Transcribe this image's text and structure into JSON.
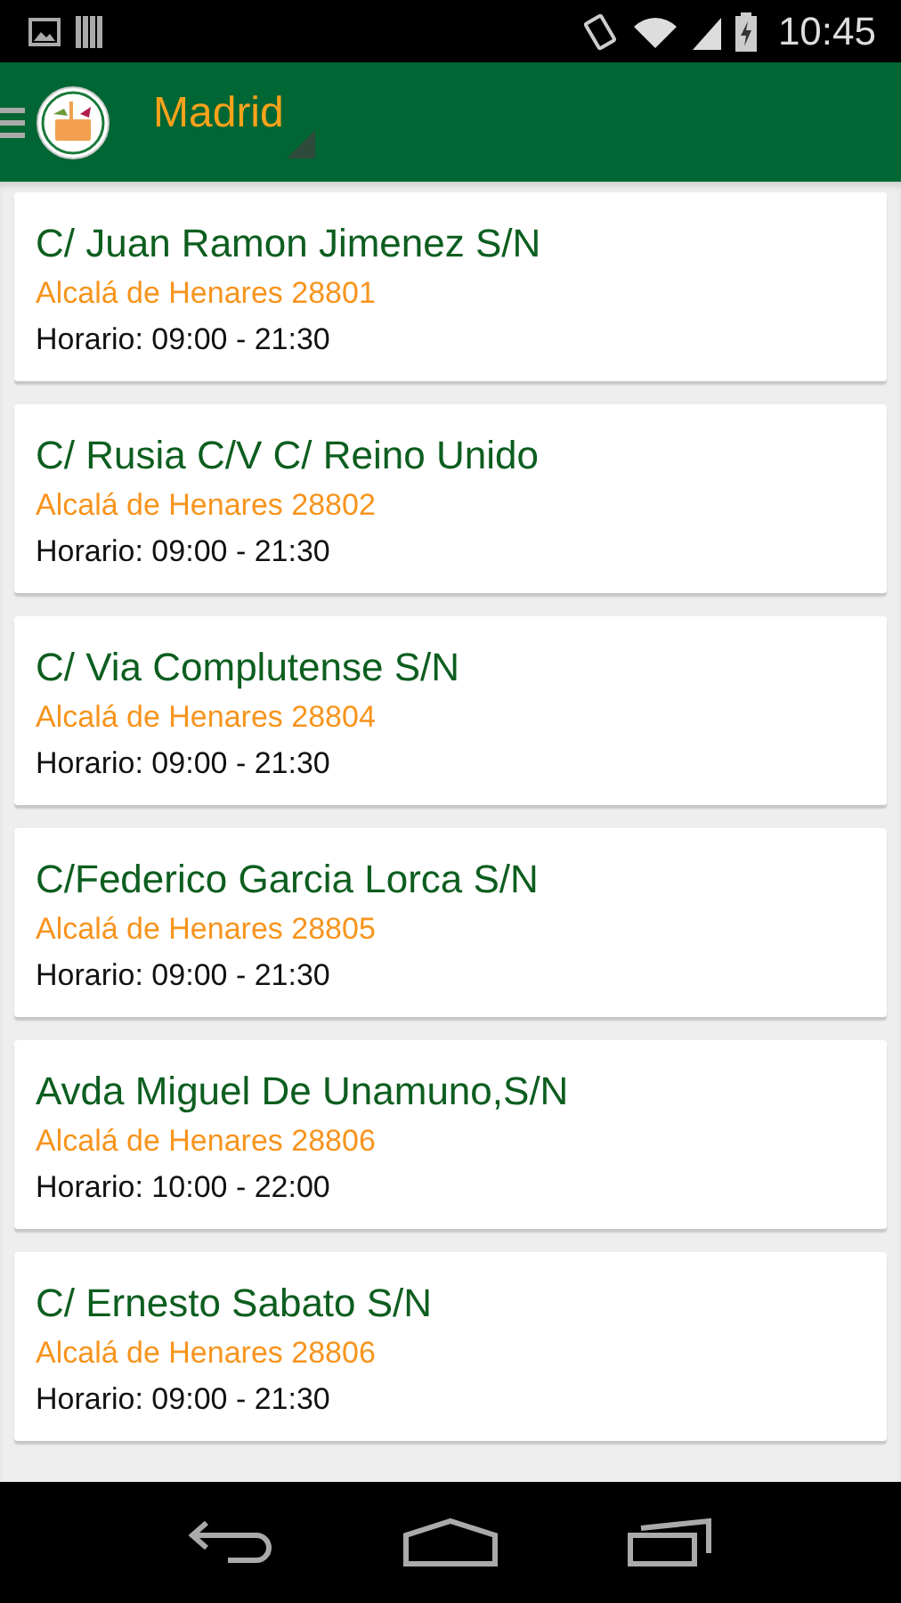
{
  "status_bar": {
    "time": "10:45"
  },
  "header": {
    "title": "Madrid"
  },
  "stores": [
    {
      "address": "C/ Juan Ramon Jimenez S/N",
      "city": "Alcalá de Henares 28801",
      "hours": "Horario: 09:00 - 21:30"
    },
    {
      "address": "C/ Rusia C/V C/ Reino Unido",
      "city": "Alcalá de Henares 28802",
      "hours": "Horario: 09:00 - 21:30"
    },
    {
      "address": "C/ Via Complutense S/N",
      "city": "Alcalá de Henares 28804",
      "hours": "Horario: 09:00 - 21:30"
    },
    {
      "address": "C/Federico Garcia Lorca S/N",
      "city": "Alcalá de Henares 28805",
      "hours": "Horario: 09:00 - 21:30"
    },
    {
      "address": "Avda Miguel De Unamuno,S/N",
      "city": "Alcalá de Henares 28806",
      "hours": "Horario: 10:00 - 22:00"
    },
    {
      "address": "C/ Ernesto Sabato S/N",
      "city": "Alcalá de Henares 28806",
      "hours": "Horario: 09:00 - 21:30"
    }
  ]
}
